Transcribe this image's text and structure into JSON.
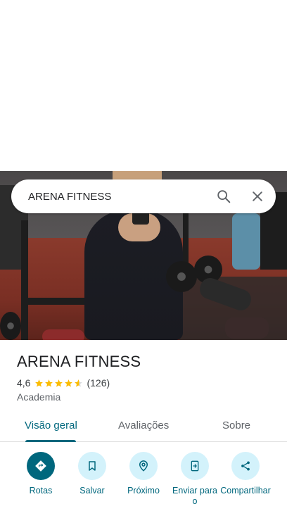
{
  "search": {
    "query": "ARENA FITNESS",
    "search_icon": "search-icon",
    "close_icon": "close-icon"
  },
  "place": {
    "name": "ARENA FITNESS",
    "rating": "4,6",
    "rating_value": 4.6,
    "review_count": "(126)",
    "category": "Academia"
  },
  "tabs": [
    {
      "label": "Visão geral",
      "active": true
    },
    {
      "label": "Avaliações",
      "active": false
    },
    {
      "label": "Sobre",
      "active": false
    }
  ],
  "actions": [
    {
      "label": "Rotas",
      "icon": "directions-icon"
    },
    {
      "label": "Salvar",
      "icon": "bookmark-icon"
    },
    {
      "label": "Próximo",
      "icon": "nearby-icon"
    },
    {
      "label": "Enviar para o",
      "icon": "send-to-phone-icon"
    },
    {
      "label": "Compartilhar",
      "icon": "share-icon"
    }
  ],
  "colors": {
    "accent": "#00677d",
    "action_bg": "#d3f2fb",
    "star": "#fbbc04"
  }
}
